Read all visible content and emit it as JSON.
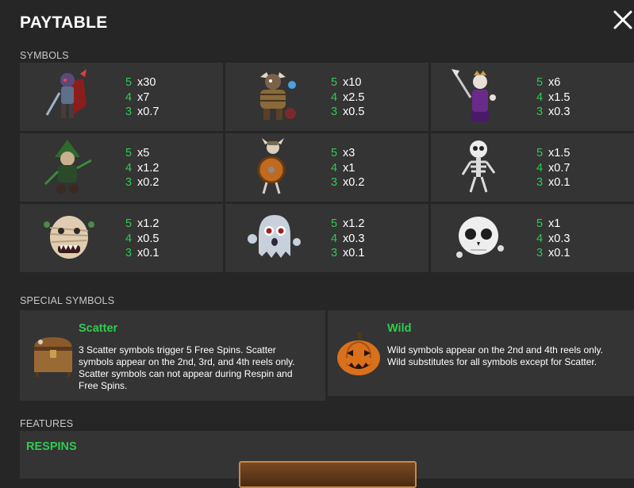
{
  "header": {
    "title": "PAYTABLE"
  },
  "sections": {
    "symbols": "SYMBOLS",
    "special": "SPECIAL SYMBOLS",
    "features": "FEATURES"
  },
  "symbols": [
    {
      "icon": "red-armored-warrior-icon",
      "pays": [
        {
          "n": "5",
          "v": "x30"
        },
        {
          "n": "4",
          "v": "x7"
        },
        {
          "n": "3",
          "v": "x0.7"
        }
      ]
    },
    {
      "icon": "barbarian-zombie-icon",
      "pays": [
        {
          "n": "5",
          "v": "x10"
        },
        {
          "n": "4",
          "v": "x2.5"
        },
        {
          "n": "3",
          "v": "x0.5"
        }
      ]
    },
    {
      "icon": "purple-skeleton-king-icon",
      "pays": [
        {
          "n": "5",
          "v": "x6"
        },
        {
          "n": "4",
          "v": "x1.5"
        },
        {
          "n": "3",
          "v": "x0.3"
        }
      ]
    },
    {
      "icon": "green-hooded-witch-icon",
      "pays": [
        {
          "n": "5",
          "v": "x5"
        },
        {
          "n": "4",
          "v": "x1.2"
        },
        {
          "n": "3",
          "v": "x0.2"
        }
      ]
    },
    {
      "icon": "viking-skeleton-shield-icon",
      "pays": [
        {
          "n": "5",
          "v": "x3"
        },
        {
          "n": "4",
          "v": "x1"
        },
        {
          "n": "3",
          "v": "x0.2"
        }
      ]
    },
    {
      "icon": "skeleton-icon",
      "pays": [
        {
          "n": "5",
          "v": "x1.5"
        },
        {
          "n": "4",
          "v": "x0.7"
        },
        {
          "n": "3",
          "v": "x0.1"
        }
      ]
    },
    {
      "icon": "mummy-head-icon",
      "pays": [
        {
          "n": "5",
          "v": "x1.2"
        },
        {
          "n": "4",
          "v": "x0.5"
        },
        {
          "n": "3",
          "v": "x0.1"
        }
      ]
    },
    {
      "icon": "ghost-icon",
      "pays": [
        {
          "n": "5",
          "v": "x1.2"
        },
        {
          "n": "4",
          "v": "x0.3"
        },
        {
          "n": "3",
          "v": "x0.1"
        }
      ]
    },
    {
      "icon": "skull-icon",
      "pays": [
        {
          "n": "5",
          "v": "x1"
        },
        {
          "n": "4",
          "v": "x0.3"
        },
        {
          "n": "3",
          "v": "x0.1"
        }
      ]
    }
  ],
  "special_symbols": {
    "scatter": {
      "icon": "treasure-chest-icon",
      "title": "Scatter",
      "lines": [
        "3 Scatter symbols trigger 5 Free Spins. Scatter",
        "symbols appear on the 2nd, 3rd, and 4th reels only.",
        "Scatter symbols can not appear during Respin and",
        "Free Spins."
      ]
    },
    "wild": {
      "icon": "jack-o-lantern-icon",
      "title": "Wild",
      "lines": [
        "Wild symbols appear on the 2nd and 4th reels only.",
        "Wild substitutes for all symbols except for Scatter."
      ]
    }
  },
  "features": {
    "respins_title": "RESPINS"
  },
  "colors": {
    "background": "#262626",
    "panel": "#343434",
    "accent_green": "#2ecc4f"
  }
}
